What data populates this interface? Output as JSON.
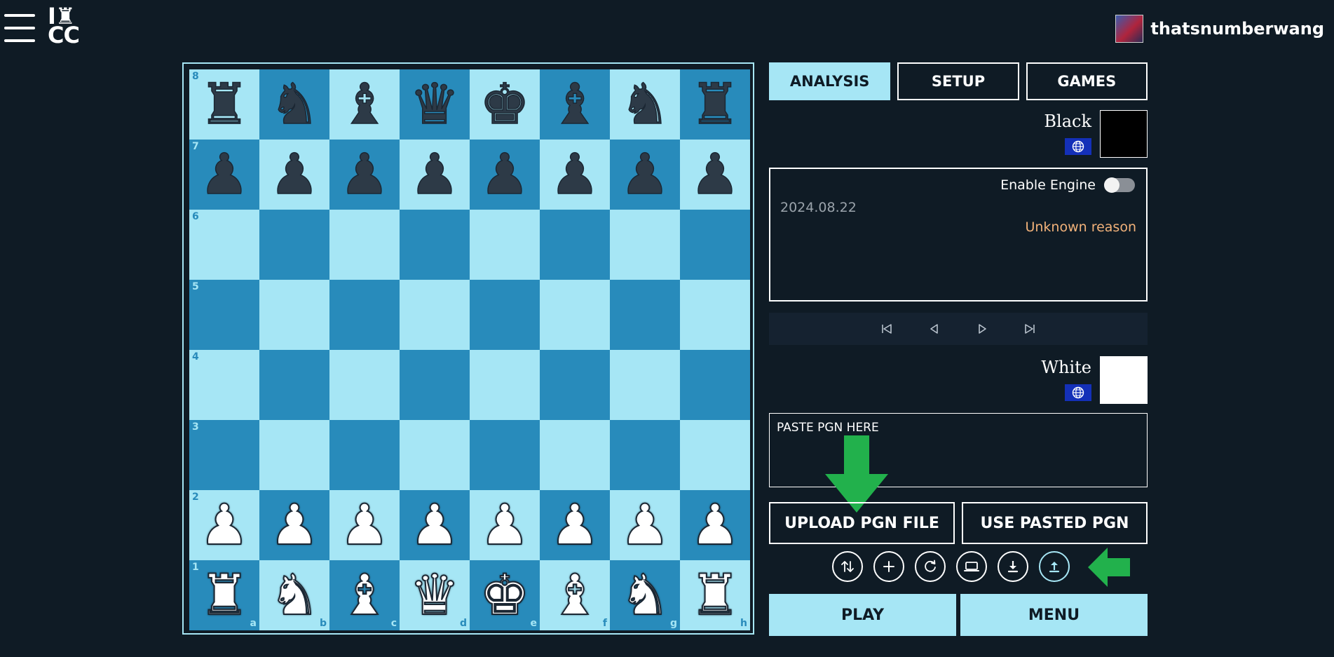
{
  "app": {
    "logo_line1": "I♜",
    "logo_line2": "CC",
    "username": "thatsnumberwang"
  },
  "tabs": [
    {
      "label": "ANALYSIS",
      "active": true
    },
    {
      "label": "SETUP",
      "active": false
    },
    {
      "label": "GAMES",
      "active": false
    }
  ],
  "black_player": {
    "name": "Black",
    "flag_icon": "globe-icon",
    "color": "#000000"
  },
  "white_player": {
    "name": "White",
    "flag_icon": "globe-icon",
    "color": "#ffffff"
  },
  "info": {
    "engine_label": "Enable Engine",
    "engine_enabled": false,
    "date": "2024.08.22",
    "result_reason": "Unknown reason"
  },
  "pgn": {
    "placeholder": "PASTE PGN HERE"
  },
  "buttons": {
    "upload": "UPLOAD PGN FILE",
    "use_pasted": "USE PASTED PGN",
    "play": "PLAY",
    "menu": "MENU"
  },
  "icons": [
    "flip-board-icon",
    "add-icon",
    "reset-icon",
    "computer-icon",
    "download-icon",
    "upload-icon"
  ],
  "colors": {
    "light_square": "#a6e6f5",
    "dark_square": "#288bbb",
    "background": "#0f1b25",
    "arrow": "#22b14c"
  },
  "board": {
    "ranks": [
      "8",
      "7",
      "6",
      "5",
      "4",
      "3",
      "2",
      "1"
    ],
    "files": [
      "a",
      "b",
      "c",
      "d",
      "e",
      "f",
      "g",
      "h"
    ],
    "position": [
      [
        "br",
        "bn",
        "bb",
        "bq",
        "bk",
        "bb",
        "bn",
        "br"
      ],
      [
        "bp",
        "bp",
        "bp",
        "bp",
        "bp",
        "bp",
        "bp",
        "bp"
      ],
      [
        "",
        "",
        "",
        "",
        "",
        "",
        "",
        ""
      ],
      [
        "",
        "",
        "",
        "",
        "",
        "",
        "",
        ""
      ],
      [
        "",
        "",
        "",
        "",
        "",
        "",
        "",
        ""
      ],
      [
        "",
        "",
        "",
        "",
        "",
        "",
        "",
        ""
      ],
      [
        "wp",
        "wp",
        "wp",
        "wp",
        "wp",
        "wp",
        "wp",
        "wp"
      ],
      [
        "wr",
        "wn",
        "wb",
        "wq",
        "wk",
        "wb",
        "wn",
        "wr"
      ]
    ]
  }
}
